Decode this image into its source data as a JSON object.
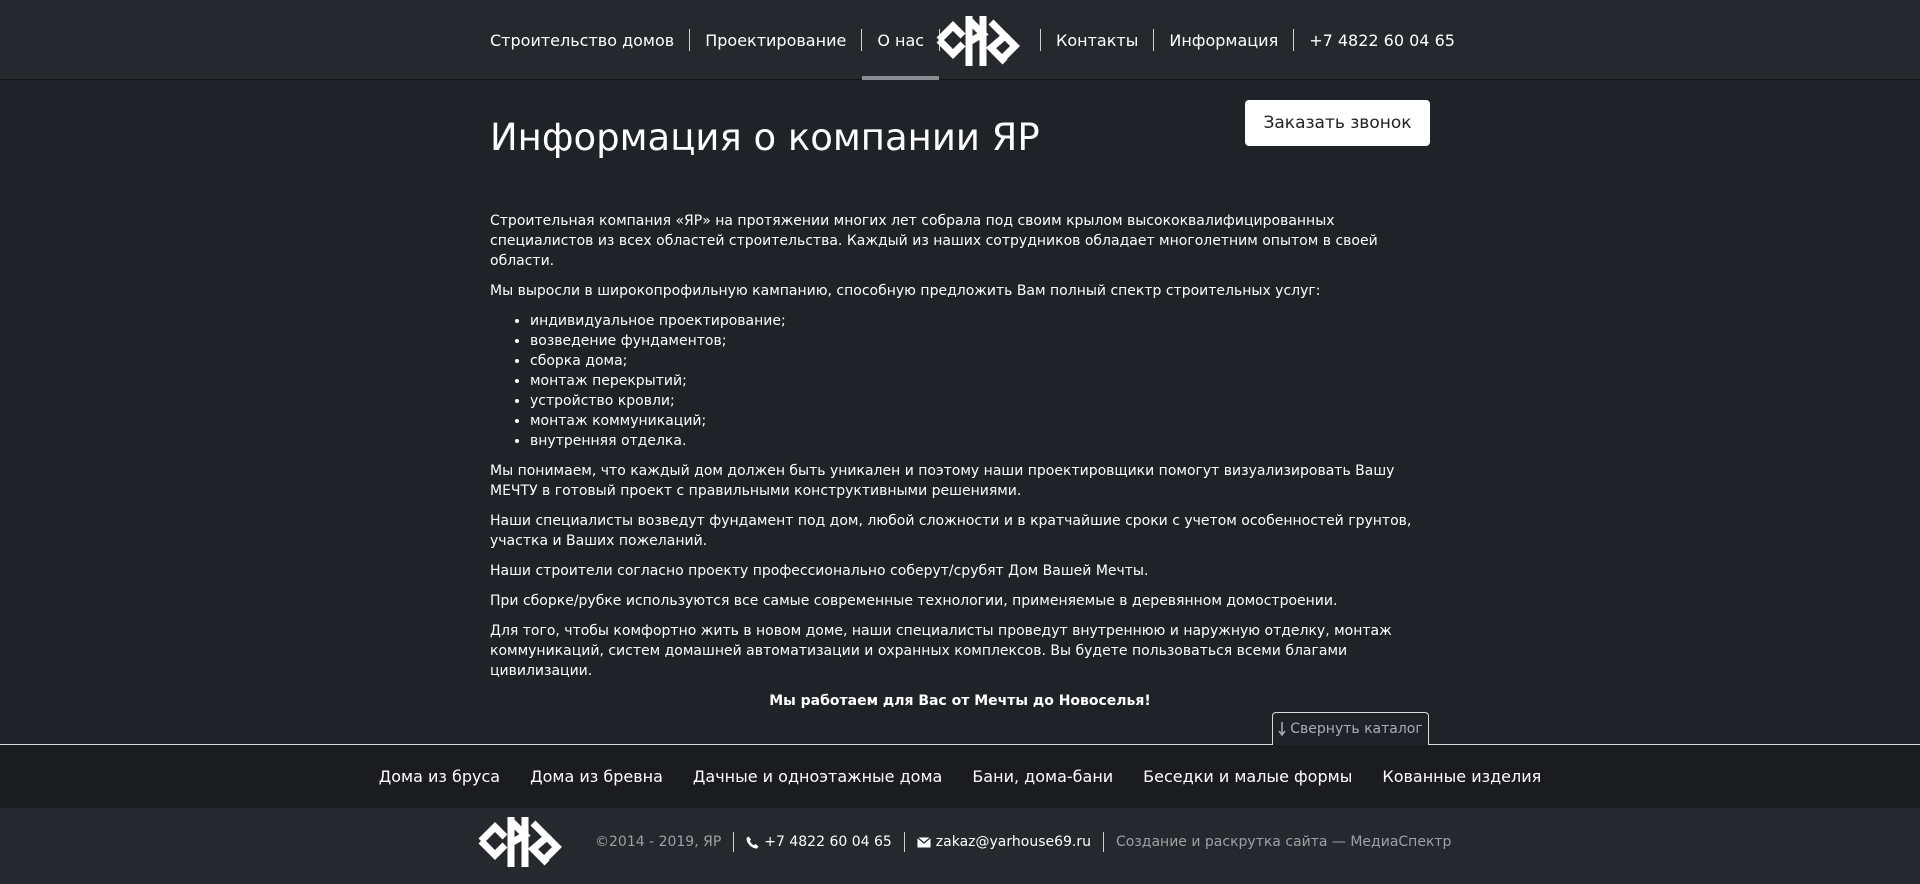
{
  "header": {
    "nav_left": [
      "Строительство домов",
      "Проектирование",
      "О нас"
    ],
    "nav_right": [
      "Контакты",
      "Информация",
      "+7 4822 60 04 65"
    ],
    "active": "О нас",
    "logo": "yar-logo"
  },
  "main": {
    "title": "Информация о компании ЯР",
    "callback_label": "Заказать звонок",
    "intro_1": "Строительная компания «ЯР» на протяжении многих лет собрала под своим крылом высококвалифицированных специалистов из всех областей строительства. Каждый из наших сотрудников обладает многолетним опытом в своей области.",
    "intro_2": "Мы выросли в широкопрофильную кампанию, способную предложить Вам полный спектр строительных услуг:",
    "services": [
      "индивидуальное проектирование;",
      "возведение фундаментов;",
      "сборка дома;",
      "монтаж перекрытий;",
      "устройство кровли;",
      "монтаж коммуникаций;",
      "внутренняя отделка."
    ],
    "para_1": "Мы понимаем, что каждый дом должен быть уникален и поэтому наши проектировщики помогут визуализировать Вашу МЕЧТУ в готовый проект с правильными конструктивными решениями.",
    "para_2": "Наши специалисты возведут фундамент под дом, любой сложности и в кратчайшие сроки с учетом особенностей грунтов, участка и Ваших пожеланий.",
    "para_3": "Наши строители согласно проекту профессионально соберут/срубят Дом Вашей Мечты.",
    "para_4": "При сборке/рубке используются все самые современные технологии, применяемые в деревянном домостроении.",
    "para_5": "Для того, чтобы комфортно жить в новом доме, наши специалисты проведут внутреннюю и наружную отделку, монтаж коммуникаций, систем домашней автоматизации и охранных комплексов. Вы будете пользоваться всеми благами цивилизации.",
    "slogan": "Мы работаем для Вас от Мечты до Новоселья!"
  },
  "catalog": {
    "collapse_label": "Свернуть каталог",
    "items": [
      "Дома из бруса",
      "Дома из бревна",
      "Дачные и одноэтажные дома",
      "Бани, дома-бани",
      "Беседки и малые формы",
      "Кованные изделия"
    ]
  },
  "footer": {
    "copyright": "©2014 - 2019, ЯР",
    "phone": "+7 4822 60 04 65",
    "email": "zakaz@yarhouse69.ru",
    "credit": "Создание и раскрутка сайта — МедиаСпектр"
  },
  "colors": {
    "background": "#1f2226",
    "header": "#25282c",
    "catalog": "#1a1c1f",
    "text": "#ffffff",
    "muted": "#9da1a6"
  }
}
